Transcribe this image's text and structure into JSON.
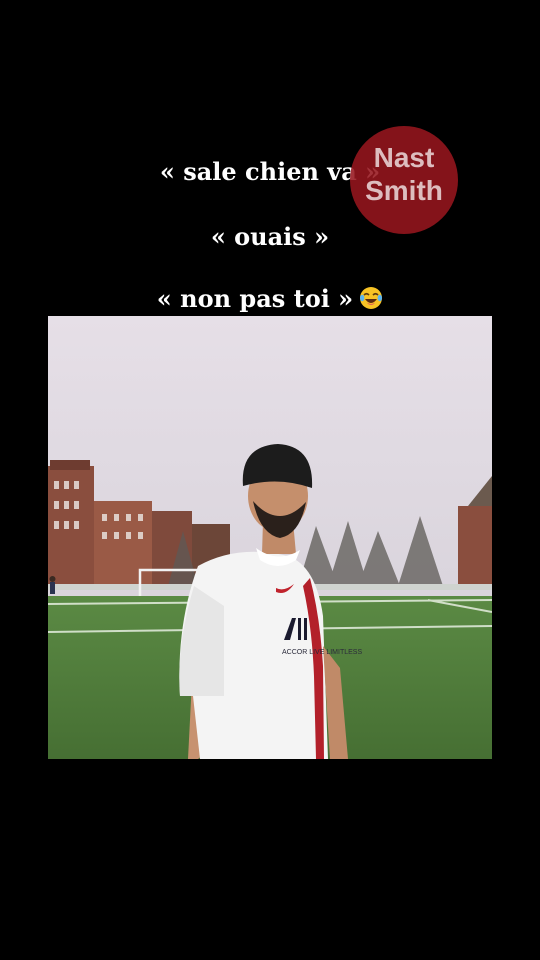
{
  "captions": {
    "line1": "« sale chien va »",
    "line2": "« ouais »",
    "line3": "« non pas toi »",
    "line3_emoji_icon": "face-with-tears-of-joy-icon"
  },
  "watermark": {
    "line1": "Nast",
    "line2": "Smith",
    "color": "#96161e"
  },
  "video": {
    "jersey_text": "ACCOR LIVE LIMITLESS",
    "colors": {
      "sky": "#e3dde4",
      "grass": "#4f7a3a",
      "jersey": "#f4f4f4",
      "beanie": "#1c1c1c"
    }
  }
}
